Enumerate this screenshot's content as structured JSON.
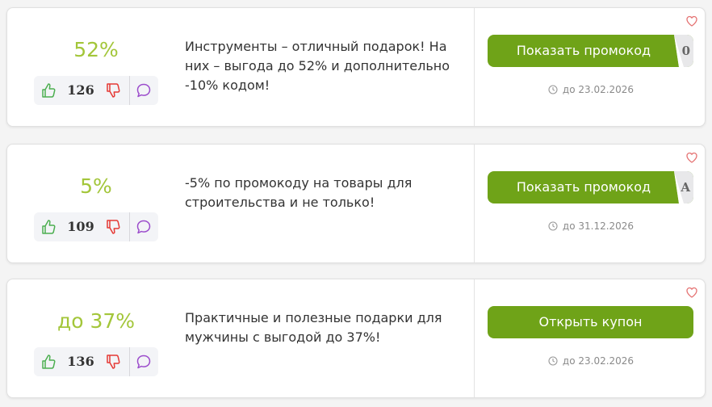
{
  "colors": {
    "accent": "#a3c63a",
    "button": "#6fa318",
    "like": "#4caf50",
    "dislike": "#e53935",
    "comment": "#9c4dcc",
    "heart": "#e57373"
  },
  "coupons": [
    {
      "discount": "52%",
      "votes": "126",
      "description": "Инструменты – отличный подарок! На них – выгода до 52% и дополнительно -10% кодом!",
      "button_label": "Показать промокод",
      "code_peek": "0",
      "expiry": "до 23.02.2026"
    },
    {
      "discount": "5%",
      "votes": "109",
      "description": "-5% по промокоду на товары для строительства и не только!",
      "button_label": "Показать промокод",
      "code_peek": "A",
      "expiry": "до 31.12.2026"
    },
    {
      "discount": "до 37%",
      "votes": "136",
      "description": "Практичные и полезные подарки для мужчины с выгодой до 37%!",
      "button_label": "Открыть купон",
      "expiry": "до 23.02.2026"
    }
  ]
}
